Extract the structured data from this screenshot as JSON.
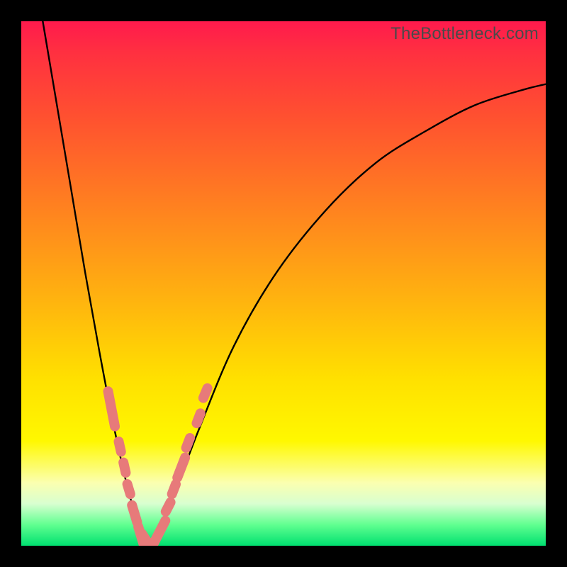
{
  "watermark": "TheBottleneck.com",
  "colors": {
    "background_frame": "#000000",
    "gradient_top": "#ff1a4d",
    "gradient_bottom": "#00e070",
    "curve_stroke": "#000000",
    "marker_fill": "#e77a7a"
  },
  "chart_data": {
    "type": "line",
    "title": "",
    "xlabel": "",
    "ylabel": "",
    "xlim": [
      0,
      1
    ],
    "ylim": [
      0,
      1
    ],
    "note": "No numeric tick labels are rendered in the source image; x and y are normalized 0–1 within the gradient frame (y=0 at bottom, y=1 at top). Values are estimated from pixel positions.",
    "series": [
      {
        "name": "left_curve",
        "x": [
          0.041,
          0.068,
          0.095,
          0.122,
          0.149,
          0.176,
          0.203,
          0.23,
          0.243
        ],
        "y": [
          1.0,
          0.84,
          0.68,
          0.52,
          0.37,
          0.23,
          0.11,
          0.02,
          0.0
        ]
      },
      {
        "name": "right_curve",
        "x": [
          0.243,
          0.284,
          0.338,
          0.405,
          0.486,
          0.581,
          0.676,
          0.77,
          0.865,
          0.959,
          1.0
        ],
        "y": [
          0.0,
          0.08,
          0.22,
          0.38,
          0.52,
          0.64,
          0.73,
          0.79,
          0.84,
          0.87,
          0.88
        ]
      }
    ],
    "markers": {
      "type": "capsule",
      "color": "#e77a7a",
      "placements": [
        {
          "branch": "left",
          "x": 0.172,
          "y": 0.261,
          "len": 0.068
        },
        {
          "branch": "left",
          "x": 0.188,
          "y": 0.189,
          "len": 0.02
        },
        {
          "branch": "left",
          "x": 0.197,
          "y": 0.149,
          "len": 0.02
        },
        {
          "branch": "left",
          "x": 0.205,
          "y": 0.108,
          "len": 0.02
        },
        {
          "branch": "left",
          "x": 0.216,
          "y": 0.061,
          "len": 0.034
        },
        {
          "branch": "left",
          "x": 0.228,
          "y": 0.02,
          "len": 0.034
        },
        {
          "branch": "left",
          "x": 0.243,
          "y": 0.003,
          "len": 0.047
        },
        {
          "branch": "right",
          "x": 0.264,
          "y": 0.027,
          "len": 0.047
        },
        {
          "branch": "right",
          "x": 0.28,
          "y": 0.074,
          "len": 0.02
        },
        {
          "branch": "right",
          "x": 0.291,
          "y": 0.108,
          "len": 0.02
        },
        {
          "branch": "right",
          "x": 0.305,
          "y": 0.149,
          "len": 0.041
        },
        {
          "branch": "right",
          "x": 0.318,
          "y": 0.196,
          "len": 0.02
        },
        {
          "branch": "right",
          "x": 0.338,
          "y": 0.243,
          "len": 0.02
        },
        {
          "branch": "right",
          "x": 0.351,
          "y": 0.291,
          "len": 0.02
        }
      ]
    }
  }
}
